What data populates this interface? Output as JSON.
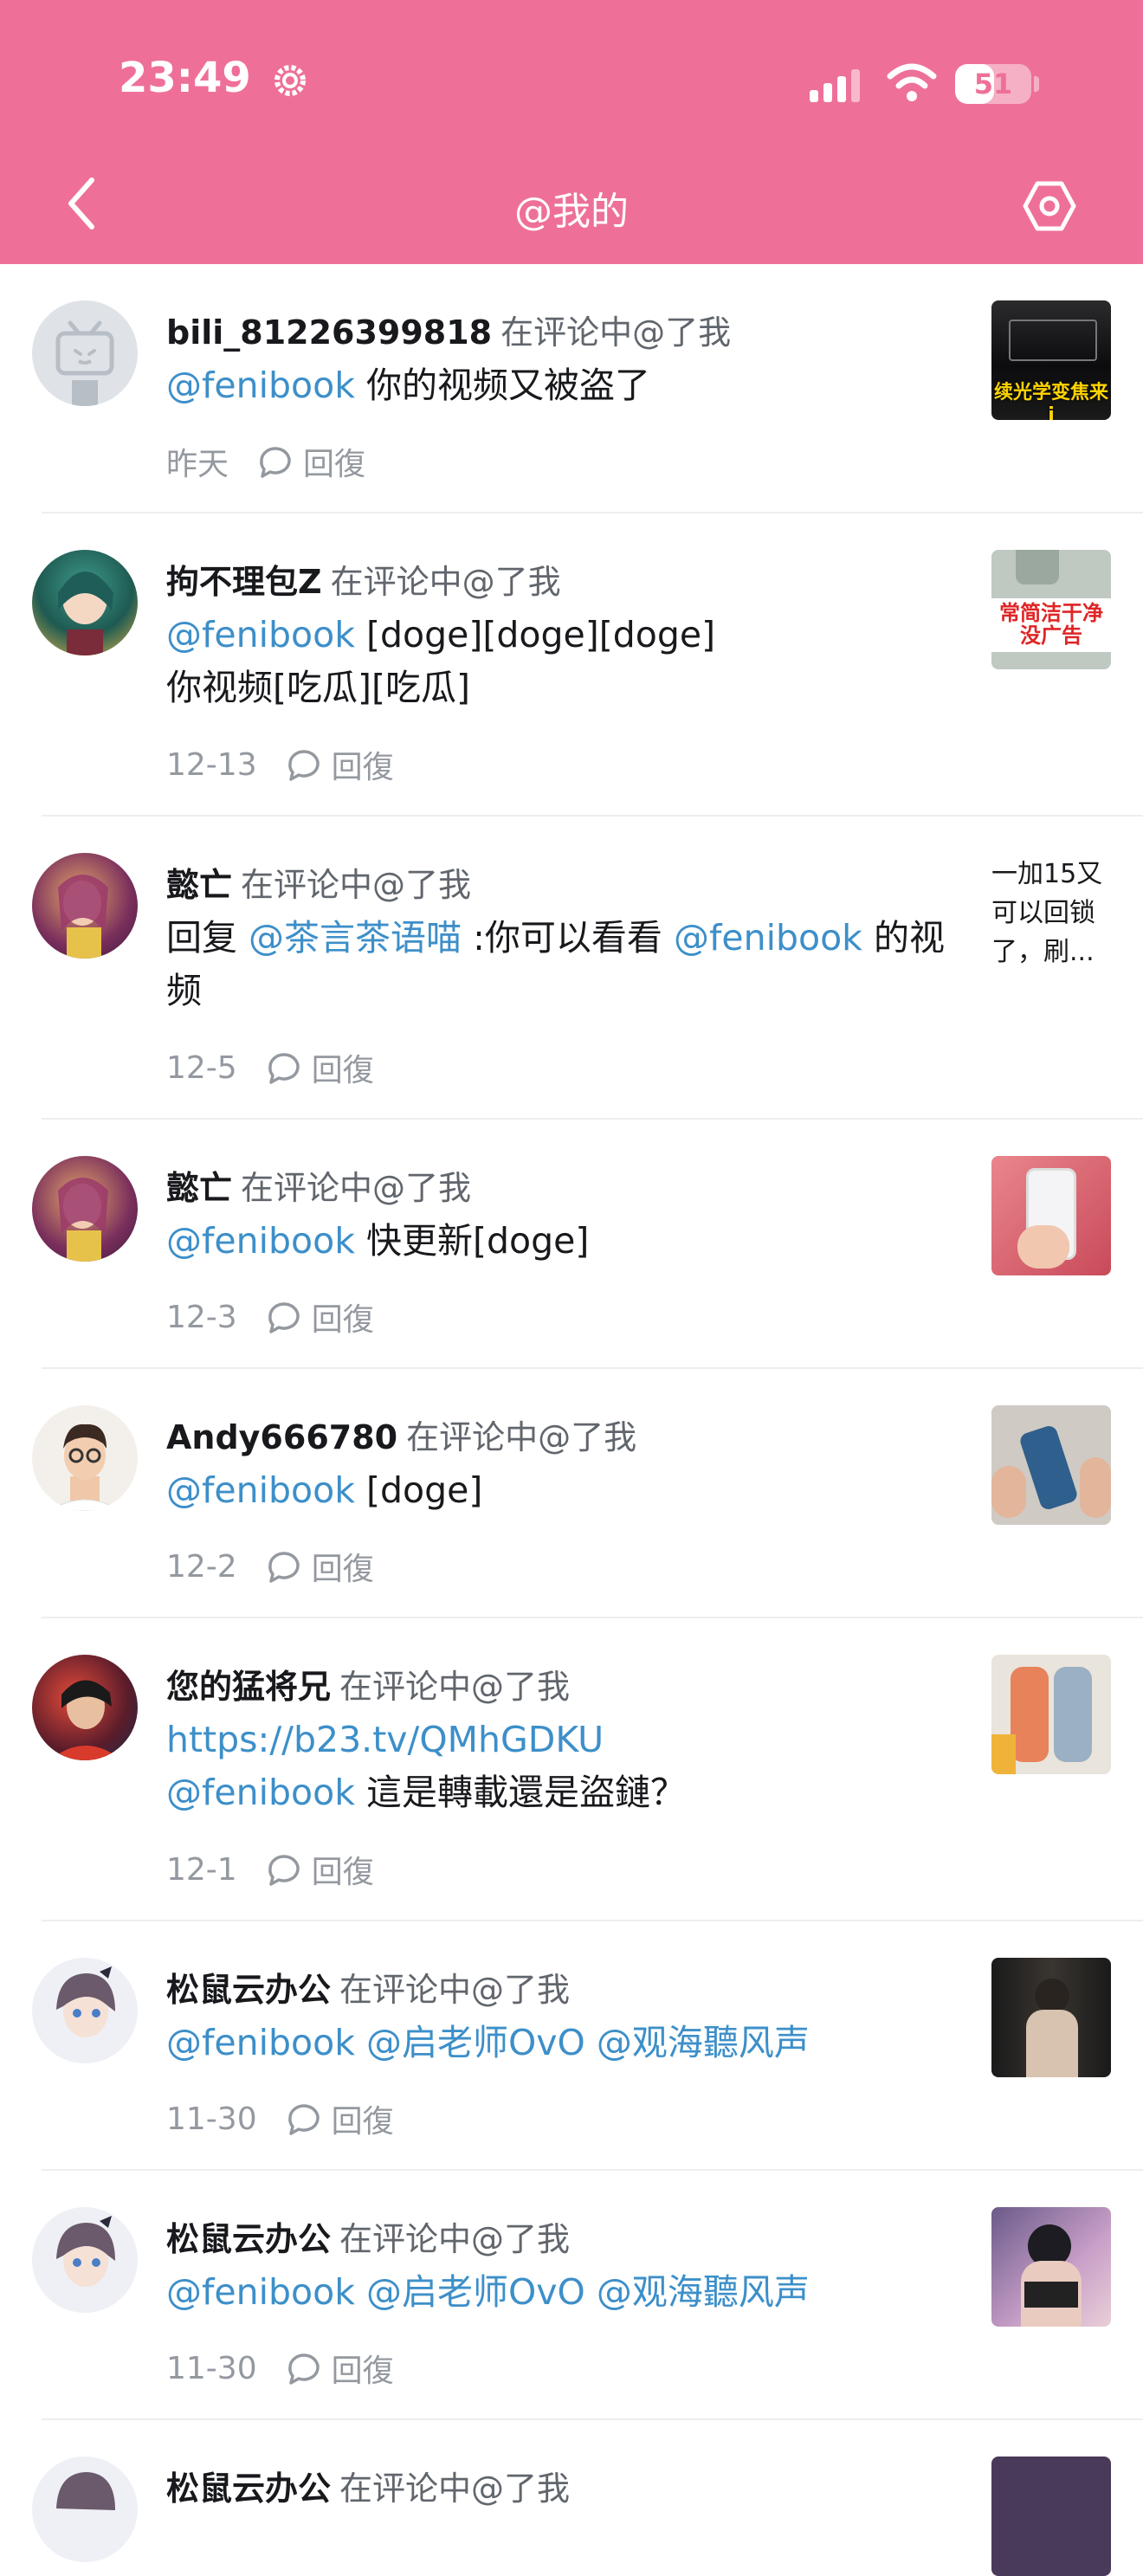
{
  "status_bar": {
    "time": "23:49",
    "battery_level": "51",
    "battery_fraction": 0.51
  },
  "nav": {
    "title": "@我的"
  },
  "colors": {
    "header": "#ee7098",
    "mention": "#3d8fc9",
    "meta": "#9499a0"
  },
  "items": [
    {
      "user": "bili_81226399818",
      "action": "在评论中@了我",
      "segments": [
        {
          "text": "@fenibook",
          "type": "mention"
        },
        {
          "text": " 你的视频又被盗了",
          "type": "text"
        }
      ],
      "date": "昨天",
      "reply_label": "回復",
      "thumb_caption": "续光学变焦来i"
    },
    {
      "user": "拘不理包Z",
      "action": "在评论中@了我",
      "segments": [
        {
          "text": "@fenibook",
          "type": "mention"
        },
        {
          "text": " [doge][doge][doge]\n你视频[吃瓜][吃瓜]",
          "type": "text"
        }
      ],
      "date": "12-13",
      "reply_label": "回復",
      "thumb_caption": "常简洁干净\n没广告"
    },
    {
      "user": "懿亡",
      "action": "在评论中@了我",
      "segments": [
        {
          "text": "回复 ",
          "type": "text"
        },
        {
          "text": "@茶言茶语喵",
          "type": "mention"
        },
        {
          "text": " :你可以看看 ",
          "type": "text"
        },
        {
          "text": "@fenibook",
          "type": "mention"
        },
        {
          "text": " 的视频",
          "type": "text"
        }
      ],
      "date": "12-5",
      "reply_label": "回復",
      "thumb_text": "一加15又可以回锁了，刷..."
    },
    {
      "user": "懿亡",
      "action": "在评论中@了我",
      "segments": [
        {
          "text": "@fenibook",
          "type": "mention"
        },
        {
          "text": " 快更新[doge]",
          "type": "text"
        }
      ],
      "date": "12-3",
      "reply_label": "回復"
    },
    {
      "user": "Andy666780",
      "action": "在评论中@了我",
      "segments": [
        {
          "text": "@fenibook",
          "type": "mention"
        },
        {
          "text": " [doge]",
          "type": "text"
        }
      ],
      "date": "12-2",
      "reply_label": "回復"
    },
    {
      "user": "您的猛将兄",
      "action": "在评论中@了我",
      "segments": [
        {
          "text": "https://b23.tv/QMhGDKU",
          "type": "mention"
        },
        {
          "text": "\n",
          "type": "text"
        },
        {
          "text": "@fenibook",
          "type": "mention"
        },
        {
          "text": " 這是轉載還是盜鏈？",
          "type": "text"
        }
      ],
      "date": "12-1",
      "reply_label": "回復"
    },
    {
      "user": "松鼠云办公",
      "action": "在评论中@了我",
      "segments": [
        {
          "text": "@fenibook @启老师OvO @观海聽风声",
          "type": "mention"
        }
      ],
      "date": "11-30",
      "reply_label": "回復"
    },
    {
      "user": "松鼠云办公",
      "action": "在评论中@了我",
      "segments": [
        {
          "text": "@fenibook @启老师OvO @观海聽风声",
          "type": "mention"
        }
      ],
      "date": "11-30",
      "reply_label": "回復"
    },
    {
      "user": "松鼠云办公",
      "action": "在评论中@了我",
      "segments": [],
      "date": "",
      "reply_label": ""
    }
  ]
}
